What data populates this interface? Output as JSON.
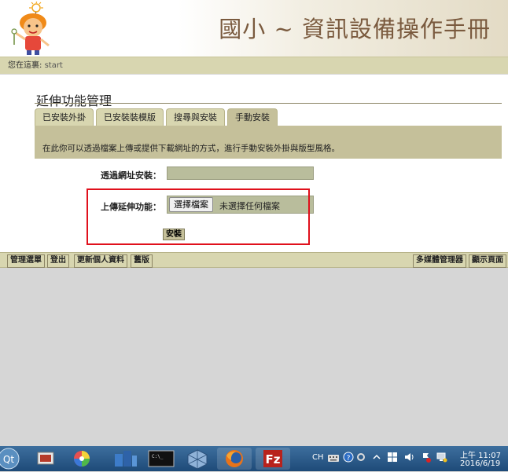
{
  "header": {
    "site_title": "國小 ~ 資訊設備操作手冊"
  },
  "breadcrumb": {
    "label": "您在這裏:",
    "item": "start"
  },
  "page": {
    "title": "延伸功能管理",
    "tabs": [
      {
        "label": "已安裝外掛",
        "active": false
      },
      {
        "label": "已安裝裝模版",
        "active": false
      },
      {
        "label": "搜尋與安裝",
        "active": false
      },
      {
        "label": "手動安裝",
        "active": true
      }
    ],
    "description": "在此你可以透過檔案上傳或提供下載網址的方式，進行手動安裝外掛與版型風格。",
    "url_label": "透過網址安裝：",
    "url_value": "",
    "upload_label": "上傳延伸功能：",
    "file_button": "選擇檔案",
    "file_status": "未選擇任何檔案",
    "install_button": "安裝"
  },
  "footer": {
    "left_buttons": [
      "管理選單",
      "登出",
      "更新個人資料",
      "舊版"
    ],
    "right_buttons": [
      "多媒體管理器",
      "顯示頁面"
    ]
  },
  "taskbar": {
    "language": "CH",
    "time": "上午 11:07",
    "date": "2016/6/19"
  },
  "colors": {
    "accent": "#d8d6b0",
    "panel": "#c5c09a",
    "highlight": "#e0101c",
    "title": "#7a5a3e"
  }
}
